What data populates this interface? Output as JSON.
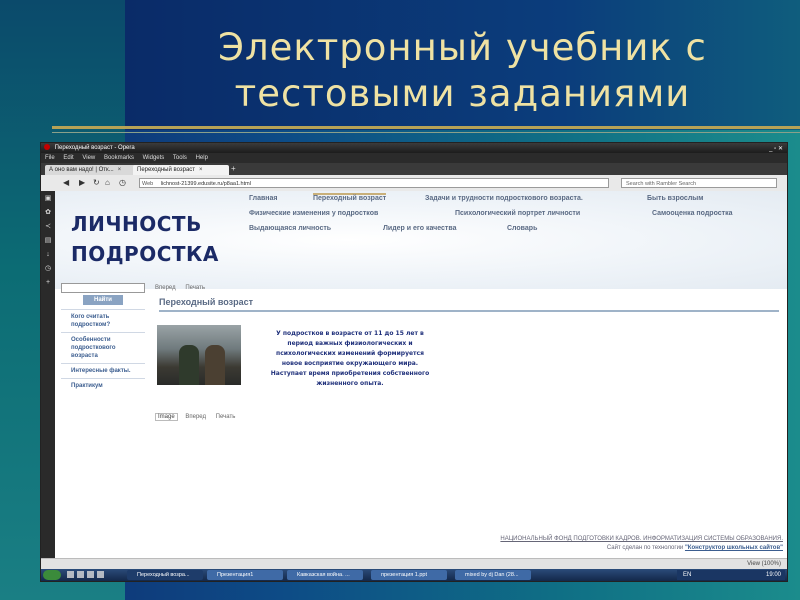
{
  "slide": {
    "title_line1": "Электронный учебник с",
    "title_line2": "тестовыми заданиями"
  },
  "browser": {
    "title": "Переходный возраст - Opera",
    "window_buttons": "_ ▫ ✕",
    "menu": [
      "File",
      "Edit",
      "View",
      "Bookmarks",
      "Widgets",
      "Tools",
      "Help"
    ],
    "tabs": [
      {
        "label": "А оно вам надо! | Отк..."
      },
      {
        "label": "Переходный возраст"
      }
    ],
    "address_prefix": "Web",
    "address": "lichnost-21399.edusite.ru/p8aa1.html",
    "search_placeholder": "Search with Rambler Search",
    "zoom": "View (100%)"
  },
  "page": {
    "logo_line1": "ЛИЧНОСТЬ",
    "logo_line2": "ПОДРОСТКА",
    "nav_row1": [
      "Главная",
      "Переходный возраст",
      "Задачи и трудности подросткового возраста.",
      "Быть взрослым"
    ],
    "nav_row2": [
      "Физические изменения у подростков",
      "Психологический портрет личности",
      "Самооценка подростка"
    ],
    "nav_row3": [
      "Выдающаяся личность",
      "Лидер и его качества",
      "Словарь"
    ],
    "search_button": "Найти",
    "left_menu": [
      "Кого считать подростком?",
      "Особенности подросткового возраста",
      "Интересные факты.",
      "Практикум"
    ],
    "crumb": [
      "Вперед",
      "Печать"
    ],
    "section_title": "Переходный возраст",
    "body_lines": [
      "У подростков в возрасте от 11 до 15 лет в",
      "период важных физиологических и",
      "психологических изменений формируется",
      "новое восприятие окружающего мира.",
      "Наступает время приобретения собственного",
      "жизненного опыта."
    ],
    "image_row": [
      "Image",
      "Вперед",
      "Печать"
    ],
    "footer_line1": "НАЦИОНАЛЬНЫЙ ФОНД ПОДГОТОВКИ КАДРОВ. ИНФОРМАТИЗАЦИЯ СИСТЕМЫ ОБРАЗОВАНИЯ.",
    "footer_line2_prefix": "Сайт сделан по технологии",
    "footer_line2_link": "\"Конструктор школьных сайтов\""
  },
  "taskbar": {
    "items": [
      "Переходный возра...",
      "Презентация1",
      "Кавказская война. ...",
      "презентация 1.ppt",
      "mixed by dj Dan (28..."
    ],
    "lang": "EN",
    "clock": "19:00"
  }
}
